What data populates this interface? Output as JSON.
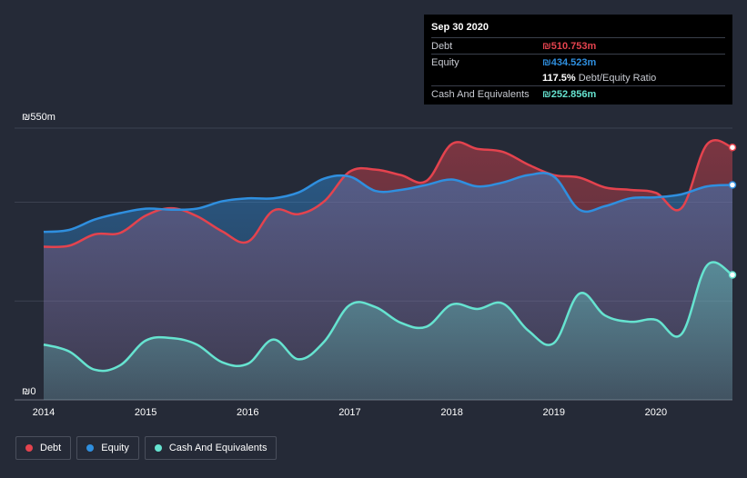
{
  "tooltip": {
    "date": "Sep 30 2020",
    "debt_label": "Debt",
    "debt_value": "₪510.753m",
    "equity_label": "Equity",
    "equity_value": "₪434.523m",
    "ratio_value": "117.5%",
    "ratio_text": "Debt/Equity Ratio",
    "cash_label": "Cash And Equivalents",
    "cash_value": "₪252.856m"
  },
  "legend": [
    {
      "label": "Debt",
      "color": "#e4434e"
    },
    {
      "label": "Equity",
      "color": "#2f8fdf"
    },
    {
      "label": "Cash And Equivalents",
      "color": "#66e3d0"
    }
  ],
  "colors": {
    "debt": "#e4434e",
    "equity": "#2f8fdf",
    "cash": "#66e3d0",
    "background": "#252a37"
  },
  "chart_data": {
    "type": "area",
    "y_tick_labels": [
      "₪550m",
      "₪0"
    ],
    "ylim": [
      0,
      550
    ],
    "xlim": [
      2014.0,
      2020.75
    ],
    "x_tick_labels": [
      "2014",
      "2015",
      "2016",
      "2017",
      "2018",
      "2019",
      "2020"
    ],
    "x_ticks": [
      2014,
      2015,
      2016,
      2017,
      2018,
      2019,
      2020
    ],
    "grid": true,
    "series": [
      {
        "name": "Debt",
        "x": [
          2014.0,
          2014.25,
          2014.5,
          2014.75,
          2015.0,
          2015.25,
          2015.5,
          2015.75,
          2016.0,
          2016.25,
          2016.5,
          2016.75,
          2017.0,
          2017.25,
          2017.5,
          2017.75,
          2018.0,
          2018.25,
          2018.5,
          2018.75,
          2019.0,
          2019.25,
          2019.5,
          2019.75,
          2020.0,
          2020.25,
          2020.5,
          2020.75
        ],
        "values": [
          310,
          312,
          335,
          338,
          373,
          388,
          372,
          341,
          320,
          383,
          376,
          402,
          462,
          466,
          455,
          443,
          518,
          508,
          502,
          476,
          455,
          450,
          430,
          425,
          419,
          388,
          517,
          511
        ]
      },
      {
        "name": "Equity",
        "x": [
          2014.0,
          2014.25,
          2014.5,
          2014.75,
          2015.0,
          2015.25,
          2015.5,
          2015.75,
          2016.0,
          2016.25,
          2016.5,
          2016.75,
          2017.0,
          2017.25,
          2017.5,
          2017.75,
          2018.0,
          2018.25,
          2018.5,
          2018.75,
          2019.0,
          2019.25,
          2019.5,
          2019.75,
          2020.0,
          2020.25,
          2020.5,
          2020.75
        ],
        "values": [
          340,
          344,
          365,
          378,
          387,
          385,
          387,
          402,
          408,
          408,
          420,
          448,
          452,
          423,
          425,
          435,
          446,
          432,
          440,
          455,
          452,
          385,
          392,
          408,
          410,
          416,
          432,
          435
        ]
      },
      {
        "name": "Cash And Equivalents",
        "x": [
          2014.0,
          2014.25,
          2014.5,
          2014.75,
          2015.0,
          2015.25,
          2015.5,
          2015.75,
          2016.0,
          2016.25,
          2016.5,
          2016.75,
          2017.0,
          2017.25,
          2017.5,
          2017.75,
          2018.0,
          2018.25,
          2018.5,
          2018.75,
          2019.0,
          2019.25,
          2019.5,
          2019.75,
          2020.0,
          2020.25,
          2020.5,
          2020.75
        ],
        "values": [
          112,
          98,
          61,
          70,
          120,
          125,
          112,
          76,
          73,
          122,
          82,
          118,
          192,
          188,
          156,
          148,
          193,
          184,
          195,
          140,
          115,
          215,
          171,
          158,
          162,
          133,
          272,
          253
        ]
      }
    ]
  }
}
